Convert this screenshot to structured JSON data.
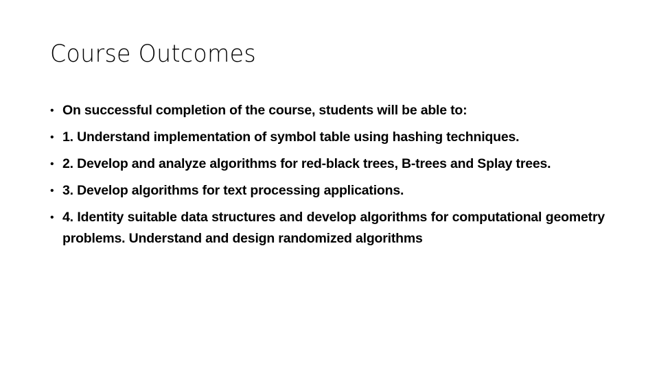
{
  "slide": {
    "title": "Course Outcomes",
    "bullet_glyph": "•",
    "bullets": [
      "On successful completion of the course, students will be able to:",
      "1. Understand implementation of symbol table using hashing techniques.",
      "2. Develop and analyze algorithms for red-black trees, B-trees and Splay trees.",
      "3. Develop algorithms for text processing applications.",
      "4. Identity suitable data structures and develop algorithms for computational geometry problems. Understand and design randomized algorithms"
    ]
  }
}
